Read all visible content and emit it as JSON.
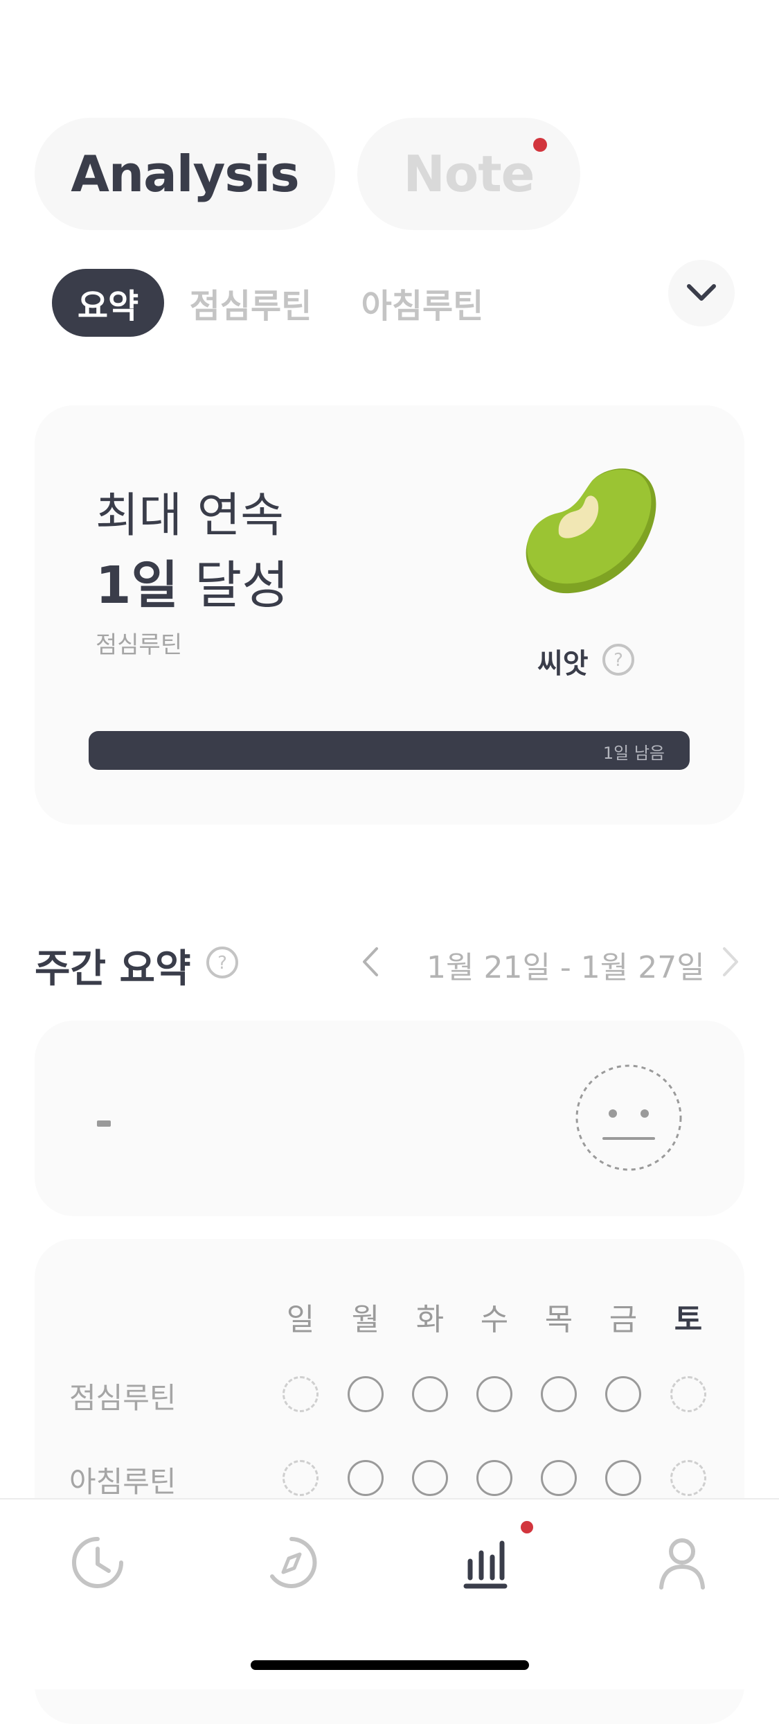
{
  "top_tabs": {
    "analysis": "Analysis",
    "note": "Note"
  },
  "sub_tabs": [
    {
      "label": "요약",
      "active": true
    },
    {
      "label": "점심루틴",
      "active": false
    },
    {
      "label": "아침루틴",
      "active": false
    }
  ],
  "streak_card": {
    "heading": "최대 연속",
    "value": "1일",
    "value_suffix": "달성",
    "routine": "점심루틴",
    "level": "씨앗",
    "progress_label": "1일 남음",
    "progress_fraction": 1.0
  },
  "weekly": {
    "title": "주간 요약",
    "range": "1월 21일 - 1월 27일",
    "summary_text": "-"
  },
  "calendar": {
    "days": [
      "일",
      "월",
      "화",
      "수",
      "목",
      "금",
      "토"
    ],
    "rows": [
      {
        "label": "점심루틴",
        "states": [
          "none",
          "open",
          "open",
          "open",
          "open",
          "open",
          "none"
        ]
      },
      {
        "label": "아침루틴",
        "states": [
          "none",
          "open",
          "open",
          "open",
          "open",
          "open",
          "none"
        ]
      }
    ]
  },
  "bottom_nav": [
    {
      "icon": "clock-icon",
      "active": false
    },
    {
      "icon": "compass-icon",
      "active": false
    },
    {
      "icon": "bar-chart-icon",
      "active": true,
      "badge": true
    },
    {
      "icon": "profile-icon",
      "active": false
    }
  ],
  "colors": {
    "primary": "#3a3d4a",
    "accent_red": "#d2353d",
    "bean_green": "#9bc433",
    "muted": "#c4c4c4"
  }
}
